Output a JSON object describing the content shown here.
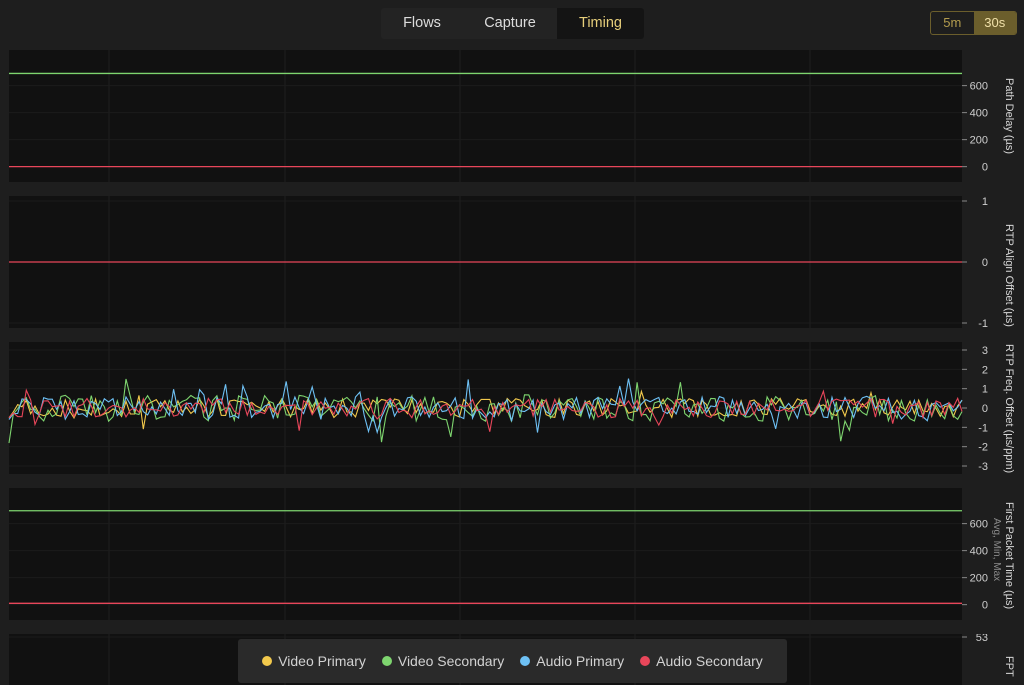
{
  "tabs": [
    {
      "label": "Flows",
      "active": false
    },
    {
      "label": "Capture",
      "active": false
    },
    {
      "label": "Timing",
      "active": true
    }
  ],
  "range": [
    {
      "label": "5m",
      "active": false
    },
    {
      "label": "30s",
      "active": true
    }
  ],
  "colors": {
    "video_primary": "#f2c94c",
    "video_secondary": "#7ed56f",
    "audio_primary": "#6ec1f5",
    "audio_secondary": "#e8465a"
  },
  "legend": [
    {
      "label": "Video Primary",
      "color": "#f2c94c"
    },
    {
      "label": "Video Secondary",
      "color": "#7ed56f"
    },
    {
      "label": "Audio Primary",
      "color": "#6ec1f5"
    },
    {
      "label": "Audio Secondary",
      "color": "#e8465a"
    }
  ],
  "chart_data": [
    {
      "type": "line",
      "ylabel": "Path Delay (µs)",
      "ylim": [
        -10,
        760
      ],
      "yticks": [
        "0",
        "200",
        "400",
        "600"
      ],
      "series": [
        {
          "name": "Video Secondary",
          "constant": 690
        },
        {
          "name": "Audio Secondary",
          "constant": 0
        }
      ]
    },
    {
      "type": "line",
      "ylabel": "RTP Align Offset (µs)",
      "ylim": [
        -1,
        1
      ],
      "yticks": [
        "-1",
        "0",
        "1"
      ],
      "series": [
        {
          "name": "Audio Secondary",
          "constant": 0
        }
      ]
    },
    {
      "type": "line",
      "ylabel": "RTP Freq. Offset (µs/ppm)",
      "ylim": [
        -3,
        3
      ],
      "yticks": [
        "-3",
        "-2",
        "-1",
        "0",
        "1",
        "2",
        "3"
      ],
      "series": [
        {
          "name": "Video Primary",
          "noise_amplitude": 0.5
        },
        {
          "name": "Video Secondary",
          "noise_amplitude": 0.7
        },
        {
          "name": "Audio Primary",
          "noise_amplitude": 0.6
        },
        {
          "name": "Audio Secondary",
          "noise_amplitude": 0.5
        }
      ]
    },
    {
      "type": "line",
      "ylabel": "First Packet Time (µs)",
      "ylabel_sub": "Avg, Min, Max",
      "ylim": [
        -10,
        760
      ],
      "yticks": [
        "0",
        "200",
        "400",
        "600"
      ],
      "series": [
        {
          "name": "Video Secondary",
          "constant": 695
        },
        {
          "name": "Audio Secondary",
          "constant": 10
        }
      ]
    },
    {
      "type": "line",
      "ylabel": "FPT",
      "yticks": [
        "53"
      ],
      "series": []
    }
  ]
}
